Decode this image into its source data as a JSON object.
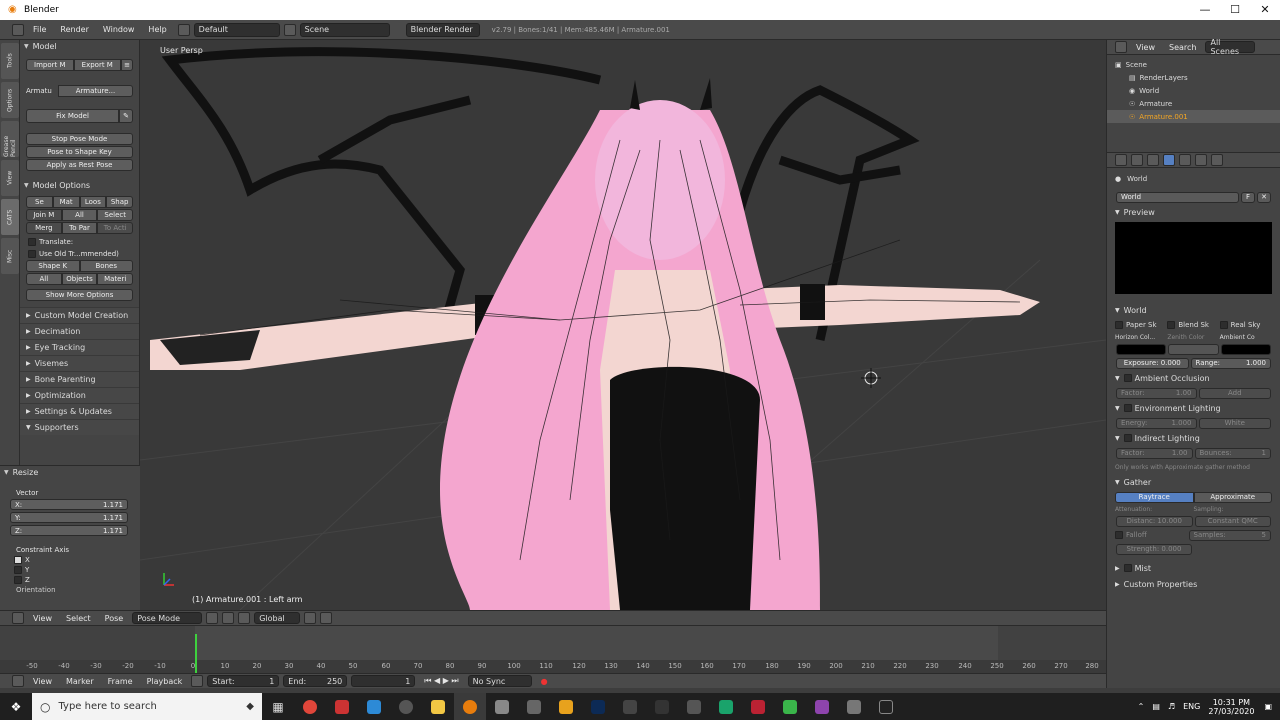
{
  "window": {
    "title": "Blender",
    "controls": [
      "—",
      "☐",
      "✕"
    ]
  },
  "infobar": {
    "menus": [
      "File",
      "Render",
      "Window",
      "Help"
    ],
    "layout": "Default",
    "scene": "Scene",
    "engine": "Blender Render",
    "stats": "v2.79 | Bones:1/41 | Mem:485.46M | Armature.001"
  },
  "tabs": [
    "Tools",
    "Options",
    "Grease Pencil",
    "View",
    "CATS",
    "Misc"
  ],
  "shelf": {
    "model_header": "Model",
    "import_label": "Import M",
    "export_label": "Export M",
    "armature_label": "Armatu",
    "armature_value": "Armature...",
    "fix_model": "Fix Model",
    "stop_pose": "Stop Pose Mode",
    "pose_shape": "Pose to Shape Key",
    "apply_rest": "Apply as Rest Pose",
    "model_options": "Model Options",
    "opt_row1": [
      "Se",
      "Mat",
      "Loos",
      "Shap"
    ],
    "opt_row2": [
      "Join M",
      "All",
      "Select"
    ],
    "opt_row3": [
      "Merg",
      "To Par",
      "To Acti"
    ],
    "translate": "Translate:",
    "use_old": "Use Old Tr...mmended)",
    "tr_row1": [
      "Shape K",
      "Bones"
    ],
    "tr_row2": [
      "All",
      "Objects",
      "Materi"
    ],
    "show_more": "Show More Options",
    "sections": [
      "Custom Model Creation",
      "Decimation",
      "Eye Tracking",
      "Visemes",
      "Bone Parenting",
      "Optimization",
      "Settings & Updates",
      "Supporters"
    ]
  },
  "operator": {
    "title": "Resize",
    "vector_label": "Vector",
    "x_label": "X:",
    "x_value": "1.171",
    "y_label": "Y:",
    "y_value": "1.171",
    "z_label": "Z:",
    "z_value": "1.171",
    "constraint_label": "Constraint Axis",
    "axes": [
      "X",
      "Y",
      "Z"
    ],
    "orientation_label": "Orientation"
  },
  "viewport": {
    "view_label": "User Persp",
    "object_label": "(1) Armature.001 : Left arm"
  },
  "viewport_header": {
    "menus": [
      "View",
      "Select",
      "Pose"
    ],
    "mode": "Pose Mode",
    "orientation": "Global"
  },
  "timeline": {
    "ticks": [
      "-50",
      "-40",
      "-30",
      "-20",
      "-10",
      "0",
      "10",
      "20",
      "30",
      "40",
      "50",
      "60",
      "70",
      "80",
      "90",
      "100",
      "110",
      "120",
      "130",
      "140",
      "150",
      "160",
      "170",
      "180",
      "190",
      "200",
      "210",
      "220",
      "230",
      "240",
      "250",
      "260",
      "270",
      "280"
    ],
    "menus": [
      "View",
      "Marker",
      "Frame",
      "Playback"
    ],
    "start_label": "Start:",
    "start_value": "1",
    "end_label": "End:",
    "end_value": "250",
    "current_frame": "1",
    "sync": "No Sync"
  },
  "outliner": {
    "view": "View",
    "search": "Search",
    "filter": "All Scenes",
    "items": [
      "Scene",
      "RenderLayers",
      "World",
      "Armature",
      "Armature.001"
    ]
  },
  "props": {
    "breadcrumb": "World",
    "world_name": "World",
    "world_f": "F",
    "preview_label": "Preview",
    "world_section": "World",
    "paper_sky": "Paper Sk",
    "blend_sky": "Blend Sk",
    "real_sky": "Real Sky",
    "horizon_label": "Horizon Col...",
    "zenith_label": "Zenith Color",
    "ambient_label": "Ambient Co",
    "exposure": "Exposure: 0.000",
    "range": "Range:",
    "range_value": "1.000",
    "ao": "Ambient Occlusion",
    "ao_factor": "Factor:",
    "ao_factor_value": "1.00",
    "ao_mode": "Add",
    "env": "Environment Lighting",
    "env_energy": "Energy:",
    "env_energy_value": "1.000",
    "env_color": "White",
    "indirect": "Indirect Lighting",
    "ind_factor": "Factor:",
    "ind_factor_value": "1.00",
    "bounces": "Bounces:",
    "bounces_value": "1",
    "ind_note": "Only works with Approximate gather method",
    "gather": "Gather",
    "raytrace": "Raytrace",
    "approximate": "Approximate",
    "attenuation": "Attenuation:",
    "sampling": "Sampling:",
    "distance": "Distanc: 10.000",
    "qmc": "Constant QMC",
    "falloff": "Falloff",
    "samples": "Samples:",
    "samples_value": "5",
    "strength": "Strength: 0.000",
    "mist": "Mist",
    "custom": "Custom Properties"
  },
  "taskbar": {
    "search_placeholder": "Type here to search",
    "lang": "ENG",
    "time": "10:31 PM",
    "date": "27/03/2020"
  },
  "colors": {
    "accent": "#e87d0d",
    "selected_text": "#f5a623",
    "playhead": "#3ed13e",
    "header_bg": "#4a4a4a",
    "panel_bg": "#444444",
    "viewport_bg": "#393939"
  }
}
